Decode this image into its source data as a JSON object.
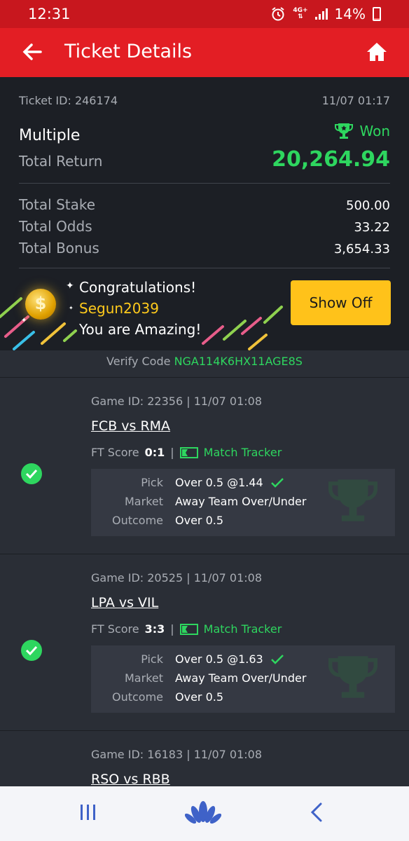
{
  "status_bar": {
    "time": "12:31",
    "network": "4G+",
    "battery": "14%",
    "battery_level": 0.14
  },
  "app_bar": {
    "title": "Ticket Details",
    "back_icon": "arrow-left-icon",
    "home_icon": "home-icon"
  },
  "ticket": {
    "id_label": "Ticket ID: 246174",
    "datetime": "11/07 01:17",
    "bet_type": "Multiple",
    "status": "Won",
    "total_return_label": "Total Return",
    "total_return": "20,264.94",
    "total_stake_label": "Total Stake",
    "total_stake": "500.00",
    "total_odds_label": "Total Odds",
    "total_odds": "33.22",
    "total_bonus_label": "Total Bonus",
    "total_bonus": "3,654.33"
  },
  "congrats": {
    "line1": "Congratulations!",
    "username": "Segun2039",
    "line3": "You are Amazing!",
    "show_off_label": "Show Off"
  },
  "verify": {
    "label": "Verify Code",
    "code": "NGA114K6HX11AGE8S"
  },
  "games": [
    {
      "meta": "Game ID: 22356 | 11/07 01:08",
      "teams": "FCB vs RMA",
      "ft_label": "FT Score",
      "score": "0:1",
      "tracker_label": "Match Tracker",
      "pick_label": "Pick",
      "pick": "Over 0.5 @1.44",
      "market_label": "Market",
      "market": "Away Team Over/Under",
      "outcome_label": "Outcome",
      "outcome": "Over 0.5"
    },
    {
      "meta": "Game ID: 20525 | 11/07 01:08",
      "teams": "LPA vs VIL",
      "ft_label": "FT Score",
      "score": "3:3",
      "tracker_label": "Match Tracker",
      "pick_label": "Pick",
      "pick": "Over 0.5 @1.63",
      "market_label": "Market",
      "market": "Away Team Over/Under",
      "outcome_label": "Outcome",
      "outcome": "Over 0.5"
    },
    {
      "meta": "Game ID: 16183 | 11/07 01:08",
      "teams": "RSO vs RBB"
    }
  ],
  "colors": {
    "brand_red": "#e31e24",
    "won_green": "#2ed65f",
    "accent_yellow": "#ffc21a"
  }
}
